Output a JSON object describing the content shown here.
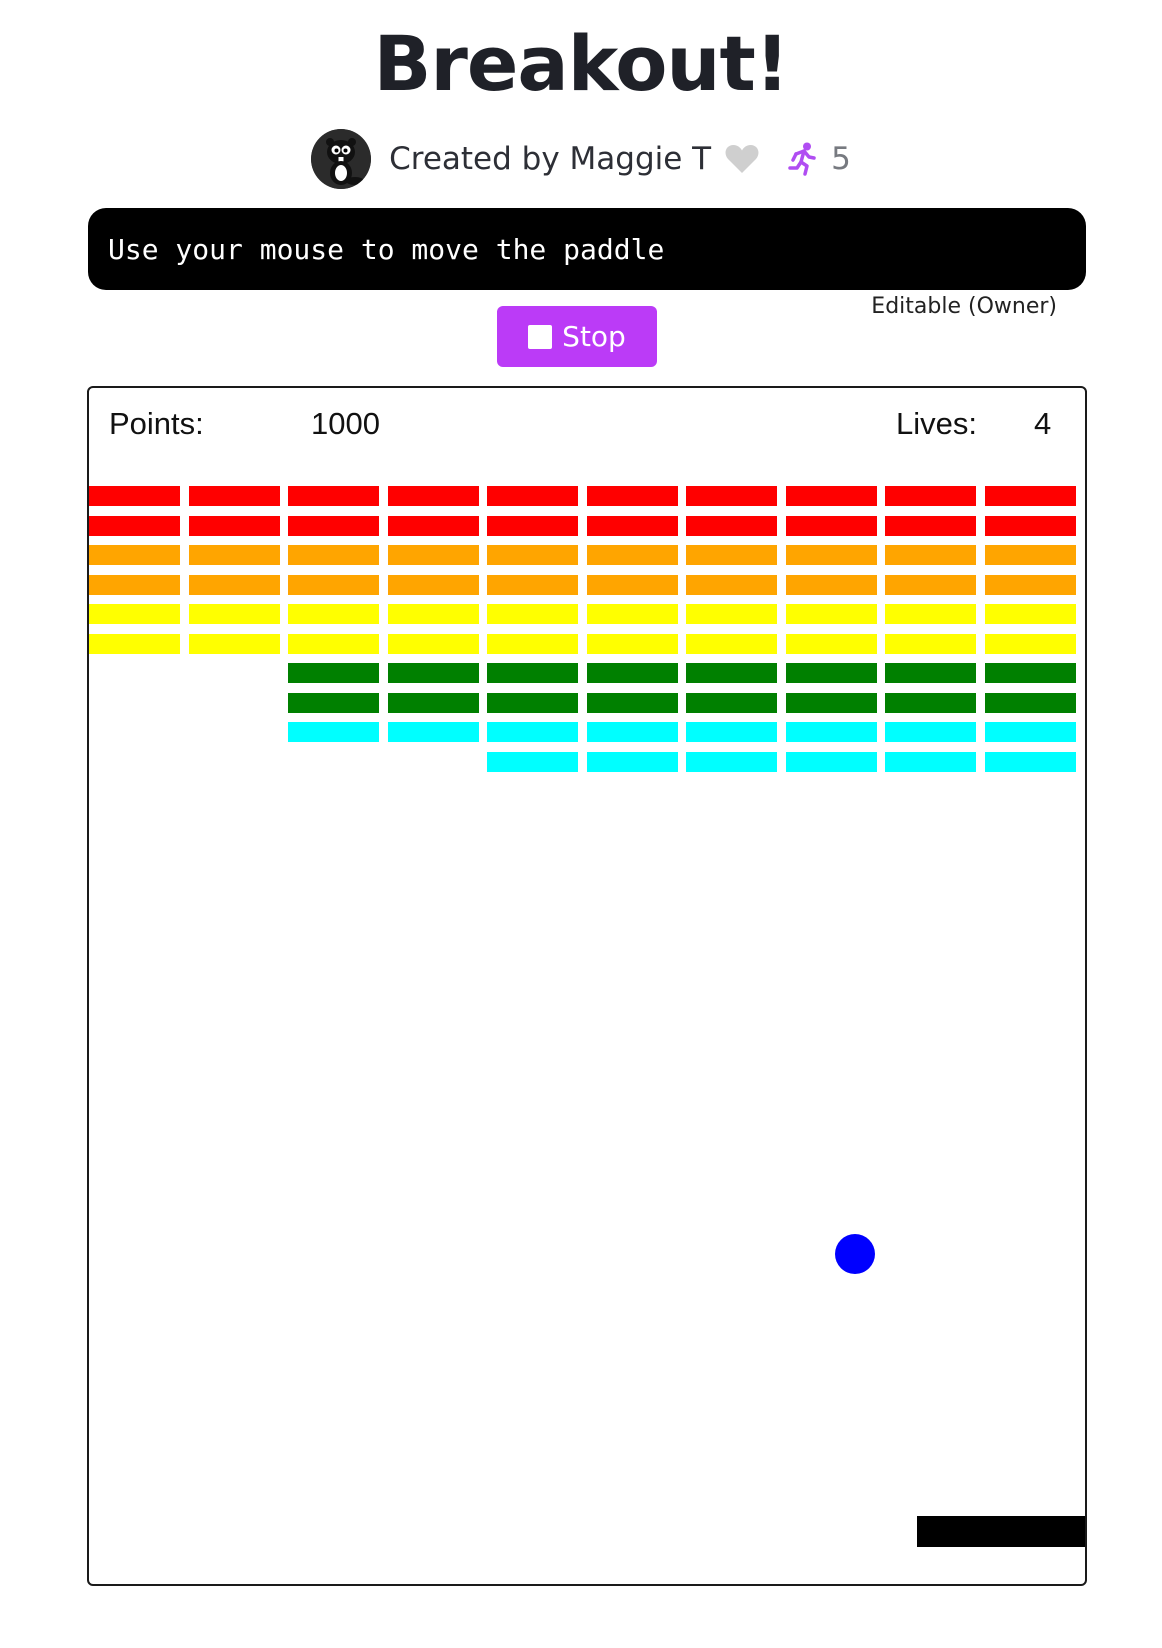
{
  "header": {
    "title": "Breakout!",
    "author": "Created by Maggie T",
    "plays": "5"
  },
  "instructions": "Use your mouse to move the paddle",
  "controls": {
    "stop_label": "Stop",
    "editable_label": "Editable (Owner)"
  },
  "game": {
    "points_label": "Points:",
    "points_value": "1000",
    "lives_label": "Lives:",
    "lives_value": "4",
    "brick_colors": [
      "#ff0000",
      "#ff0000",
      "#ffa500",
      "#ffa500",
      "#ffff00",
      "#ffff00",
      "#008000",
      "#008000",
      "#00ffff",
      "#00ffff"
    ],
    "brick_grid": [
      [
        1,
        1,
        1,
        1,
        1,
        1,
        1,
        1,
        1,
        1
      ],
      [
        1,
        1,
        1,
        1,
        1,
        1,
        1,
        1,
        1,
        1
      ],
      [
        1,
        1,
        1,
        1,
        1,
        1,
        1,
        1,
        1,
        1
      ],
      [
        1,
        1,
        1,
        1,
        1,
        1,
        1,
        1,
        1,
        1
      ],
      [
        1,
        1,
        1,
        1,
        1,
        1,
        1,
        1,
        1,
        1
      ],
      [
        1,
        1,
        1,
        1,
        1,
        1,
        1,
        1,
        1,
        1
      ],
      [
        0,
        0,
        1,
        1,
        1,
        1,
        1,
        1,
        1,
        1
      ],
      [
        0,
        0,
        1,
        1,
        1,
        1,
        1,
        1,
        1,
        1
      ],
      [
        0,
        0,
        1,
        1,
        1,
        1,
        1,
        1,
        1,
        1
      ],
      [
        0,
        0,
        0,
        0,
        1,
        1,
        1,
        1,
        1,
        1
      ]
    ],
    "ball_color": "#0000ff",
    "paddle_color": "#000000"
  },
  "colors": {
    "accent": "#bb3bf7",
    "instruction_bg": "#000000"
  }
}
